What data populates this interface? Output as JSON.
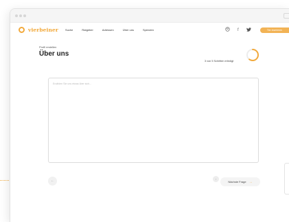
{
  "brand": {
    "name": "vierbeiner",
    "accent": "#f2a93b"
  },
  "nav": {
    "links": [
      "Suche",
      "Ratgeber",
      "Adressen",
      "Über uns",
      "Spenden"
    ],
    "icons": [
      "user-icon",
      "facebook-icon",
      "twitter-icon"
    ],
    "cta_label": "Tier inserieren"
  },
  "page": {
    "breadcrumb": "Profil erstellen",
    "title": "Über uns",
    "progress_text": "3 von 5 Schritten erledigt",
    "progress_fraction": 0.6
  },
  "form": {
    "placeholder": "Erzählen Sie uns etwas über sich..."
  },
  "footer": {
    "back_label": "←",
    "skip_label": "›",
    "next_label": "Nächste Frage",
    "next_icon": "arrow-right-icon"
  }
}
